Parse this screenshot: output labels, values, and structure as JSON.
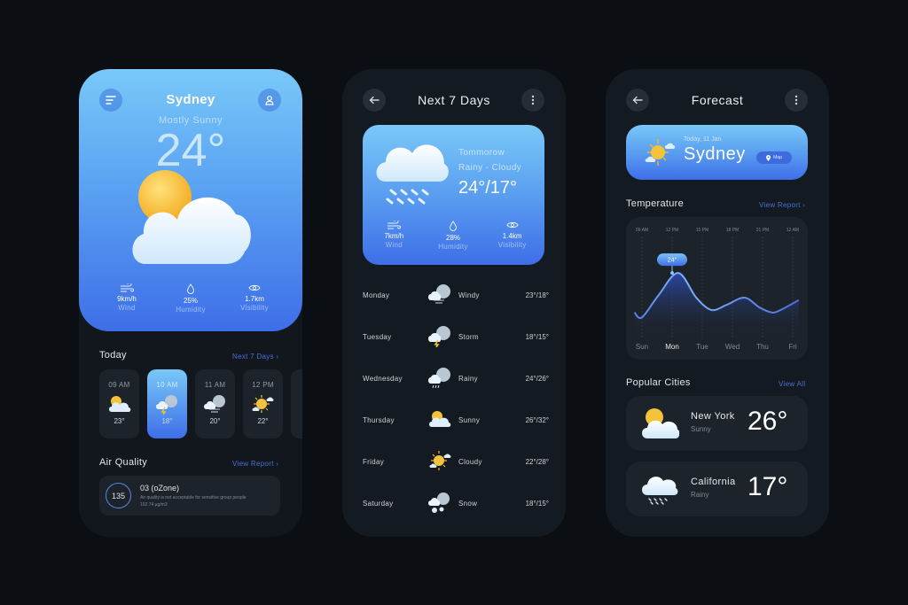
{
  "colors": {
    "background": "#0b0e12",
    "card": "#1d232b",
    "accent": "#4b6fd8",
    "gradient_top": "#79c8f8",
    "gradient_bottom": "#3e6ee8"
  },
  "home": {
    "menu_icon": "menu-icon",
    "profile_icon": "user-icon",
    "city": "Sydney",
    "condition": "Mostly Sunny",
    "temperature": "24°",
    "weather_icon": "sun-cloud-icon",
    "stats": [
      {
        "icon": "wind-icon",
        "value": "9km/h",
        "label": "Wind"
      },
      {
        "icon": "droplet-icon",
        "value": "25%",
        "label": "Humidity"
      },
      {
        "icon": "eye-icon",
        "value": "1.7km",
        "label": "Visibility"
      }
    ],
    "today_title": "Today",
    "next_days_link": "Next 7 Days ›",
    "hours": [
      {
        "time": "09 AM",
        "icon": "sun-cloud-icon",
        "temp": "23°",
        "active": false
      },
      {
        "time": "10 AM",
        "icon": "storm-icon",
        "temp": "18°",
        "active": true
      },
      {
        "time": "11 AM",
        "icon": "windy-icon",
        "temp": "20°",
        "active": false
      },
      {
        "time": "12 PM",
        "icon": "sunny-icon",
        "temp": "22°",
        "active": false
      }
    ],
    "air_quality_title": "Air Quality",
    "view_report_link": "View Report ›",
    "air_quality": {
      "index": "135",
      "title": "03 (oZone)",
      "description": "Air quality is not acceptable for sensitive group people",
      "concentration": "102.74 µg/m3"
    }
  },
  "next7": {
    "back_icon": "arrow-left-icon",
    "more_icon": "more-vertical-icon",
    "title": "Next 7 Days",
    "tomorrow": {
      "label": "Tommorow",
      "condition": "Rainy - Cloudy",
      "temps": "24°/17°",
      "icon": "rain-cloud-icon",
      "stats": [
        {
          "icon": "wind-icon",
          "value": "7km/h",
          "label": "Wind"
        },
        {
          "icon": "droplet-icon",
          "value": "28%",
          "label": "Humidity"
        },
        {
          "icon": "eye-icon",
          "value": "1.4km",
          "label": "Visibility"
        }
      ]
    },
    "days": [
      {
        "day": "Monday",
        "icon": "windy-icon",
        "condition": "Windy",
        "temps": "23°/18°"
      },
      {
        "day": "Tuesday",
        "icon": "storm-icon",
        "condition": "Storm",
        "temps": "18°/15°"
      },
      {
        "day": "Wednesday",
        "icon": "rainy-icon",
        "condition": "Rainy",
        "temps": "24°/26°"
      },
      {
        "day": "Thursday",
        "icon": "sun-cloud-icon",
        "condition": "Sunny",
        "temps": "26°/32°"
      },
      {
        "day": "Friday",
        "icon": "sunny-icon",
        "condition": "Cloudy",
        "temps": "22°/28°"
      },
      {
        "day": "Saturday",
        "icon": "snow-icon",
        "condition": "Snow",
        "temps": "18°/15°"
      }
    ]
  },
  "forecast": {
    "back_icon": "arrow-left-icon",
    "more_icon": "more-vertical-icon",
    "title": "Forecast",
    "date": "Today, 11 Jan",
    "city": "Sydney",
    "map_label": "Map",
    "temperature_title": "Temperature",
    "view_report_link": "View Report ›",
    "popular_title": "Popular Cities",
    "view_all_link": "View All",
    "cities": [
      {
        "name": "New York",
        "condition": "Sunny",
        "temp": "26°",
        "icon": "sun-cloud-icon"
      },
      {
        "name": "California",
        "condition": "Rainy",
        "temp": "17°",
        "icon": "rain-cloud-icon"
      }
    ]
  },
  "chart_data": {
    "type": "line",
    "title": "Temperature",
    "time_labels": [
      "09 AM",
      "12 PM",
      "15 PM",
      "18 PM",
      "21 PM",
      "12 AM"
    ],
    "categories": [
      "Sun",
      "Mon",
      "Tue",
      "Wed",
      "Thu",
      "Fri"
    ],
    "selected_category": "Mon",
    "highlight": {
      "x": "Mon",
      "label": "24°"
    },
    "series": [
      {
        "name": "Temperature",
        "x": [
          -0.25,
          0,
          0.55,
          1.2,
          1.8,
          2.3,
          2.8,
          3.4,
          3.9,
          4.3,
          4.6,
          5.2
        ],
        "values": [
          8,
          6,
          15,
          24,
          14,
          9,
          11,
          14,
          10,
          8,
          9,
          13
        ]
      }
    ],
    "ylim": [
      0,
      28
    ],
    "grid": true
  }
}
